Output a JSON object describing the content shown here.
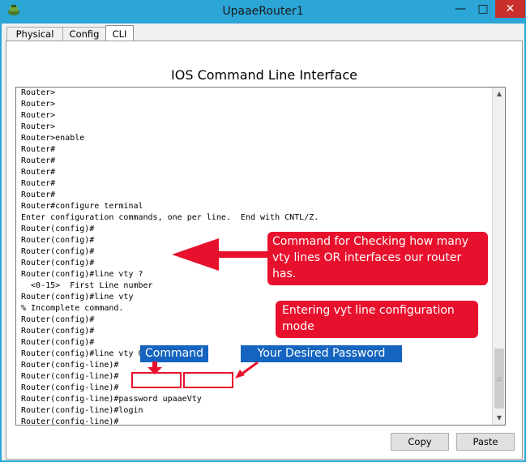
{
  "window": {
    "title": "UpaaeRouter1"
  },
  "tabs": [
    {
      "label": "Physical"
    },
    {
      "label": "Config"
    },
    {
      "label": "CLI"
    }
  ],
  "cli": {
    "heading": "IOS Command Line Interface",
    "lines": [
      "Router>",
      "Router>",
      "Router>",
      "Router>",
      "Router>enable",
      "Router#",
      "Router#",
      "Router#",
      "Router#",
      "Router#",
      "Router#configure terminal",
      "Enter configuration commands, one per line.  End with CNTL/Z.",
      "Router(config)#",
      "Router(config)#",
      "Router(config)#",
      "Router(config)#",
      "Router(config)#line vty ?",
      "  <0-15>  First Line number",
      "Router(config)#line vty",
      "% Incomplete command.",
      "Router(config)#",
      "Router(config)#",
      "Router(config)#",
      "Router(config)#line vty 0 15",
      "Router(config-line)#",
      "Router(config-line)#",
      "Router(config-line)#",
      "Router(config-line)#password upaaeVty",
      "Router(config-line)#login",
      "Router(config-line)#"
    ]
  },
  "annotations": {
    "note_vty_check": "Command for Checking how many vty lines OR interfaces our router has.",
    "note_line_mode": "Entering vyt line configuration mode",
    "label_command": "Command",
    "label_password": "Your Desired Password"
  },
  "buttons": {
    "copy": "Copy",
    "paste": "Paste"
  },
  "colors": {
    "annotation_red": "#e8112d",
    "annotation_blue": "#1565c0",
    "titlebar": "#2ba6d6"
  },
  "icons": [
    "app-icon",
    "minimize-icon",
    "maximize-icon",
    "close-icon",
    "scroll-up-icon",
    "scroll-down-icon"
  ]
}
